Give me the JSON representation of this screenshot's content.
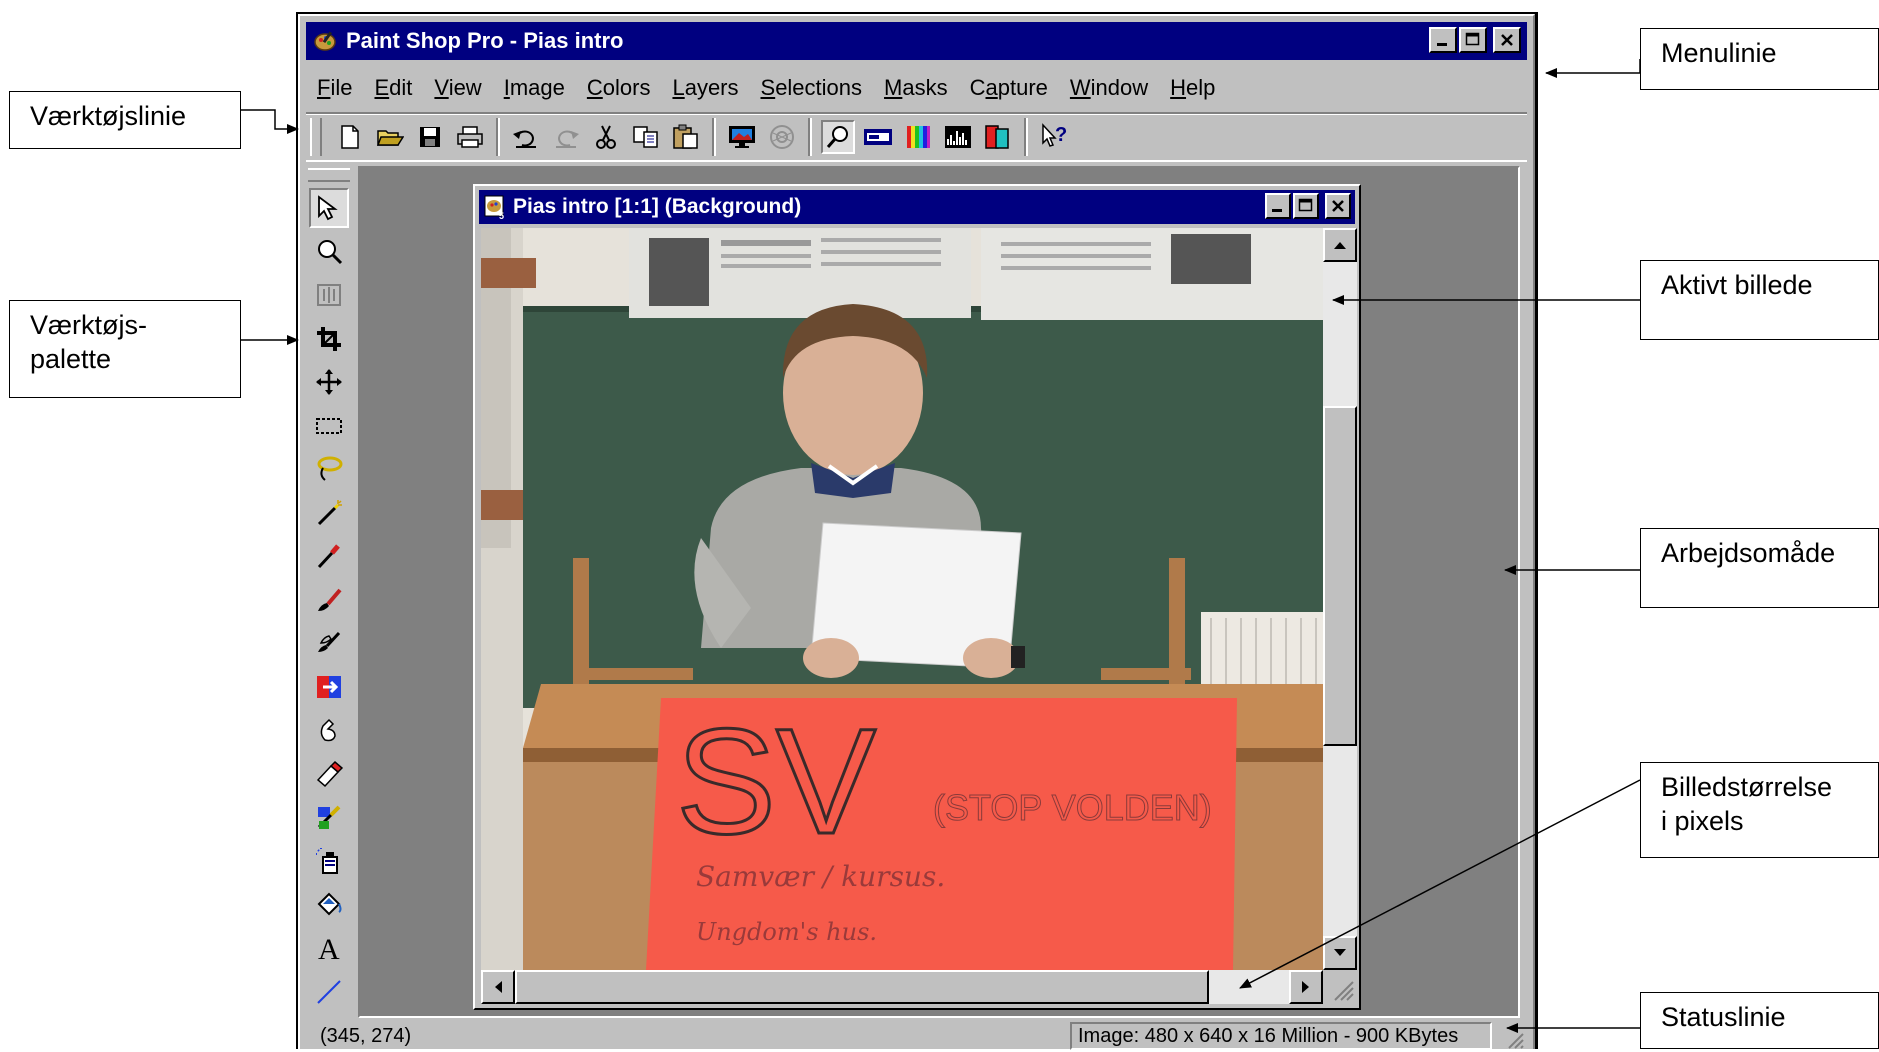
{
  "window": {
    "title": "Paint Shop Pro - Pias intro",
    "menu": [
      {
        "label": "File",
        "underline": "F",
        "rest": "ile"
      },
      {
        "label": "Edit",
        "underline": "E",
        "rest": "dit"
      },
      {
        "label": "View",
        "underline": "V",
        "rest": "iew"
      },
      {
        "label": "Image",
        "underline": "I",
        "rest": "mage"
      },
      {
        "label": "Colors",
        "underline": "C",
        "rest": "olors"
      },
      {
        "label": "Layers",
        "underline": "L",
        "rest": "ayers"
      },
      {
        "label": "Selections",
        "underline": "S",
        "rest": "elections"
      },
      {
        "label": "Masks",
        "underline": "M",
        "rest": "asks"
      },
      {
        "label": "Capture",
        "underline": "C",
        "pre": "Ca",
        "rest": "pture"
      },
      {
        "label": "Window",
        "underline": "W",
        "rest": "indow"
      },
      {
        "label": "Help",
        "underline": "H",
        "rest": "elp"
      }
    ]
  },
  "toolbar_icons": [
    "new-icon",
    "open-icon",
    "save-icon",
    "print-icon",
    "undo-icon",
    "redo-icon",
    "cut-icon",
    "copy-icon",
    "paste-icon",
    "full-screen-preview-icon",
    "browse-icon",
    "zoom-icon",
    "overview-icon",
    "color-palette-icon",
    "histogram-icon",
    "layer-palette-icon",
    "context-help-icon"
  ],
  "palette_icons": [
    "arrow-icon",
    "zoom-icon",
    "deformation-icon",
    "crop-icon",
    "mover-icon",
    "selection-icon",
    "freehand-icon",
    "magic-wand-icon",
    "dropper-icon",
    "paintbrush-icon",
    "clone-brush-icon",
    "color-replacer-icon",
    "retouch-icon",
    "eraser-icon",
    "picture-tube-icon",
    "airbrush-icon",
    "flood-fill-icon",
    "text-icon",
    "draw-icon"
  ],
  "image_window": {
    "title": "Pias intro [1:1] (Background)",
    "photo": {
      "poster_main": "SV",
      "poster_sub": "(STOP VOLDEN)",
      "poster_line1": "Samvær / kursus.",
      "poster_line2": "Ungdom's hus."
    }
  },
  "status": {
    "cursor": "(345, 274)",
    "image_info": "Image:  480 x 640 x 16 Million - 900 KBytes"
  },
  "callouts": {
    "menulinie": "Menulinie",
    "vaerktojslinie": "Værktøjslinie",
    "vaerktojspalette_line1": "Værktøjs-",
    "vaerktojspalette_line2": "palette",
    "aktivt_billede": "Aktivt billede",
    "arbejdsomrade": "Arbejdsomåde",
    "billedstorrelse_line1": "Billedstørrelse",
    "billedstorrelse_line2": "i pixels",
    "statuslinie": "Statuslinie"
  },
  "colors": {
    "titlebar": "#000080",
    "chrome": "#c0c0c0",
    "workspace": "#808080",
    "poster": "#f65a4a",
    "chalkboard": "#3d5a4a"
  }
}
